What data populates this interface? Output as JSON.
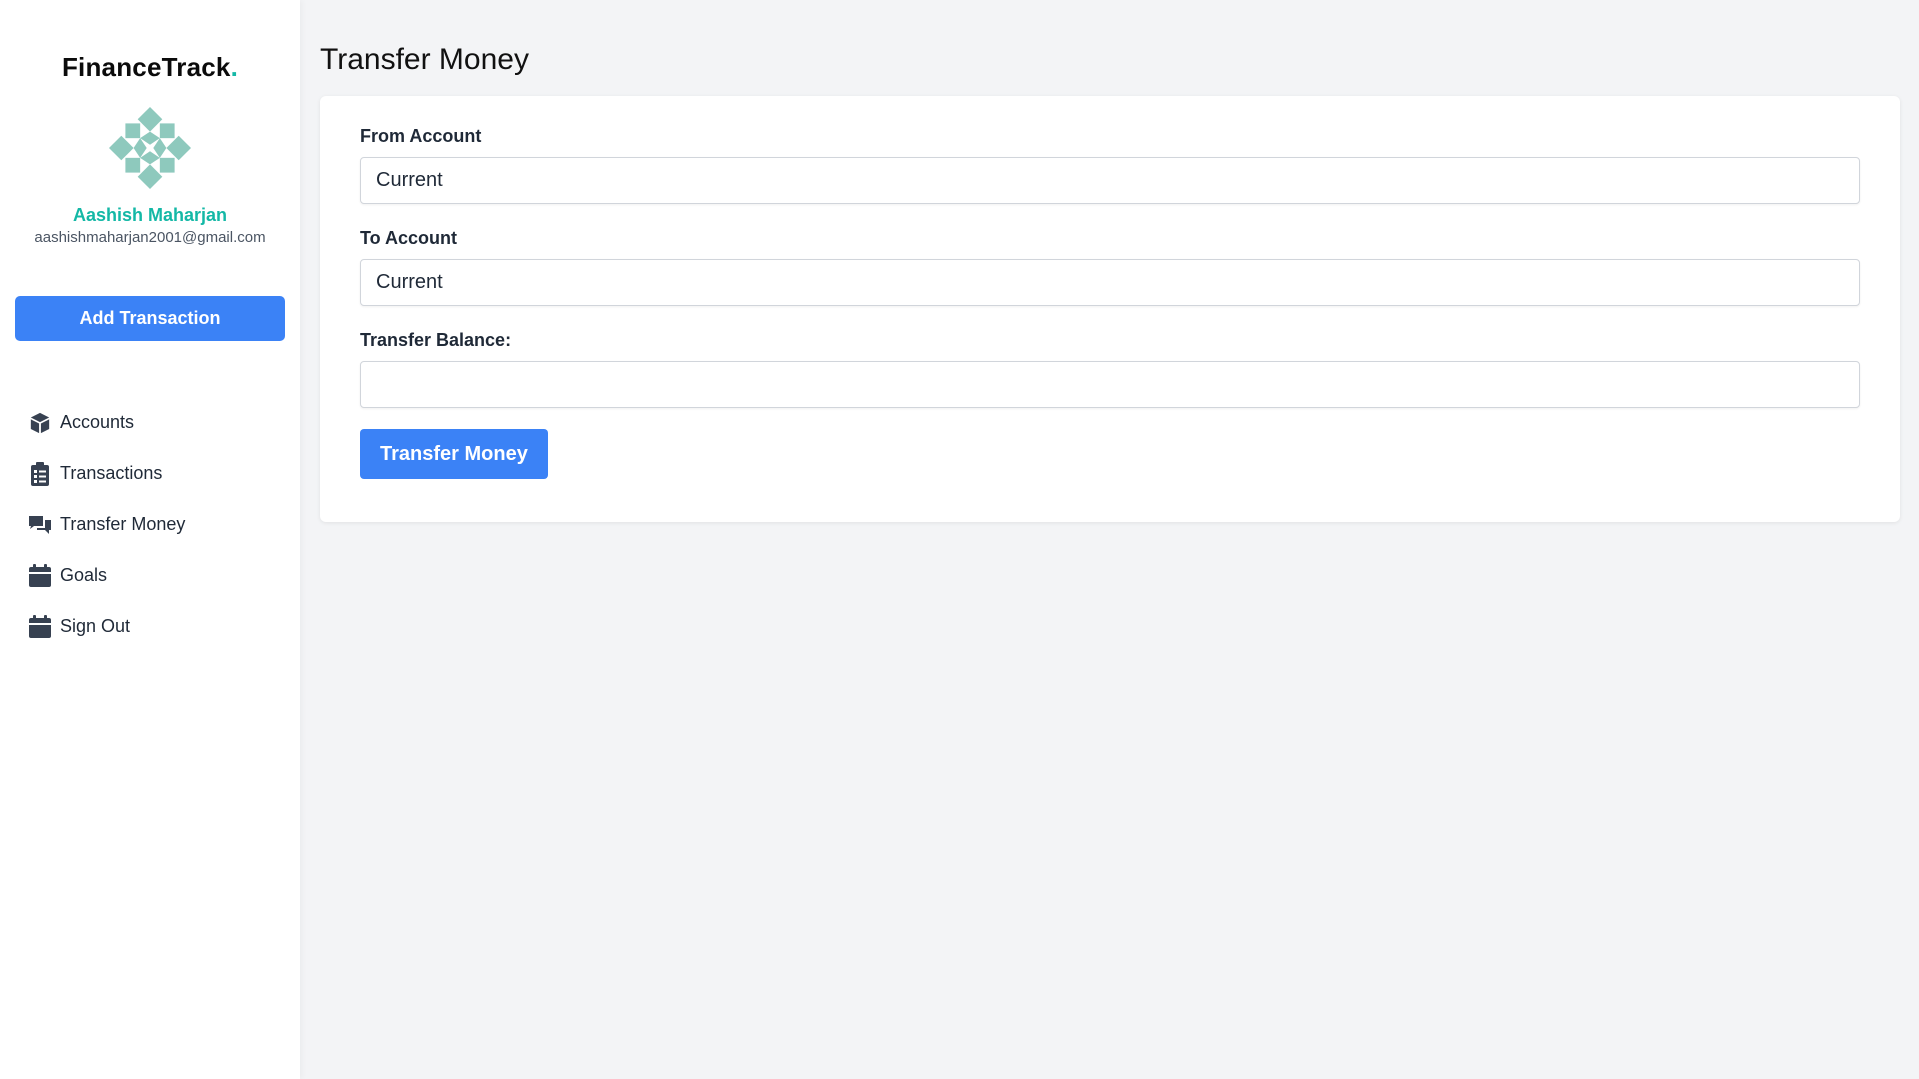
{
  "brand": {
    "name": "FinanceTrack",
    "dot": "."
  },
  "user": {
    "name": "Aashish Maharjan",
    "email": "aashishmaharjan2001@gmail.com"
  },
  "sidebar": {
    "add_button": "Add Transaction",
    "items": [
      {
        "label": "Accounts",
        "icon": "cube-icon"
      },
      {
        "label": "Transactions",
        "icon": "clipboard-list-icon"
      },
      {
        "label": "Transfer Money",
        "icon": "chat-bubbles-icon"
      },
      {
        "label": "Goals",
        "icon": "calendar-icon"
      },
      {
        "label": "Sign Out",
        "icon": "calendar-icon"
      }
    ]
  },
  "main": {
    "title": "Transfer Money",
    "form": {
      "from_label": "From Account",
      "from_value": "Current",
      "to_label": "To Account",
      "to_value": "Current",
      "balance_label": "Transfer Balance:",
      "balance_value": "",
      "submit_label": "Transfer Money"
    }
  },
  "colors": {
    "accent": "#3b82f6",
    "brand_teal": "#14b8a6",
    "avatar": "#8ec9bd",
    "icon_dark": "#374151",
    "background": "#f3f4f6"
  }
}
